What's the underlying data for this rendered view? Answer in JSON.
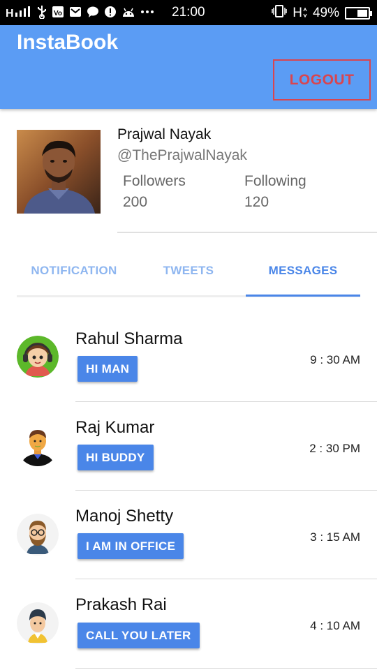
{
  "status_bar": {
    "time": "21:00",
    "battery_text": "49%",
    "battery_level": 0.49,
    "network_label": "H",
    "icons": [
      "signal-icon",
      "usb-icon",
      "vowifi-icon",
      "mail-icon",
      "chat-icon",
      "alert-icon",
      "android-icon",
      "more-icon",
      "vibrate-icon",
      "network-h-icon",
      "battery-icon"
    ]
  },
  "app_bar": {
    "title": "InstaBook",
    "logout_label": "LOGOUT",
    "color": "#5b9cf4",
    "logout_color": "#d9454f"
  },
  "profile": {
    "name": "Prajwal Nayak",
    "handle": "@ThePrajwalNayak",
    "followers_label": "Followers",
    "followers_value": "200",
    "following_label": "Following",
    "following_value": "120"
  },
  "tabs": {
    "items": [
      {
        "label": "NOTIFICATION"
      },
      {
        "label": "TWEETS"
      },
      {
        "label": "MESSAGES"
      }
    ],
    "active": "MESSAGES",
    "accent": "#4a86e8"
  },
  "messages": [
    {
      "name": "Rahul Sharma",
      "message": "HI MAN",
      "time": "9 : 30 AM",
      "avatar_icon": "girl-headphones-avatar-icon"
    },
    {
      "name": "Raj Kumar",
      "message": "HI BUDDY",
      "time": "2 : 30 PM",
      "avatar_icon": "man-bald-avatar-icon"
    },
    {
      "name": "Manoj Shetty",
      "message": "I AM IN OFFICE",
      "time": "3 : 15 AM",
      "avatar_icon": "man-glasses-beard-avatar-icon"
    },
    {
      "name": "Prakash Rai",
      "message": "CALL YOU LATER",
      "time": "4 : 10 AM",
      "avatar_icon": "man-beanie-avatar-icon"
    }
  ]
}
